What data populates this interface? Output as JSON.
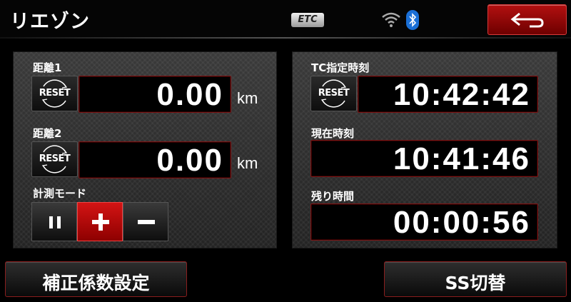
{
  "header": {
    "title": "リエゾン",
    "etc_label": "ETC",
    "icons": [
      "wifi-icon",
      "bluetooth-icon",
      "back-arrow-icon"
    ]
  },
  "left_panel": {
    "distance1": {
      "label": "距離1",
      "reset_label": "RESET",
      "value": "0.00",
      "unit": "km"
    },
    "distance2": {
      "label": "距離2",
      "reset_label": "RESET",
      "value": "0.00",
      "unit": "km"
    },
    "measure_mode": {
      "label": "計測モード",
      "modes": [
        "pause",
        "plus",
        "minus"
      ],
      "active": "plus"
    }
  },
  "right_panel": {
    "tc_time": {
      "label": "TC指定時刻",
      "reset_label": "RESET",
      "value": "10:42:42"
    },
    "current_time": {
      "label": "現在時刻",
      "value": "10:41:46"
    },
    "remaining_time": {
      "label": "残り時間",
      "value": "00:00:56"
    }
  },
  "footer": {
    "correction_button": "補正係数設定",
    "ss_button": "SS切替"
  },
  "colors": {
    "accent_red": "#b31010",
    "border_red": "#7a1616",
    "panel": "#2e2e2e"
  }
}
